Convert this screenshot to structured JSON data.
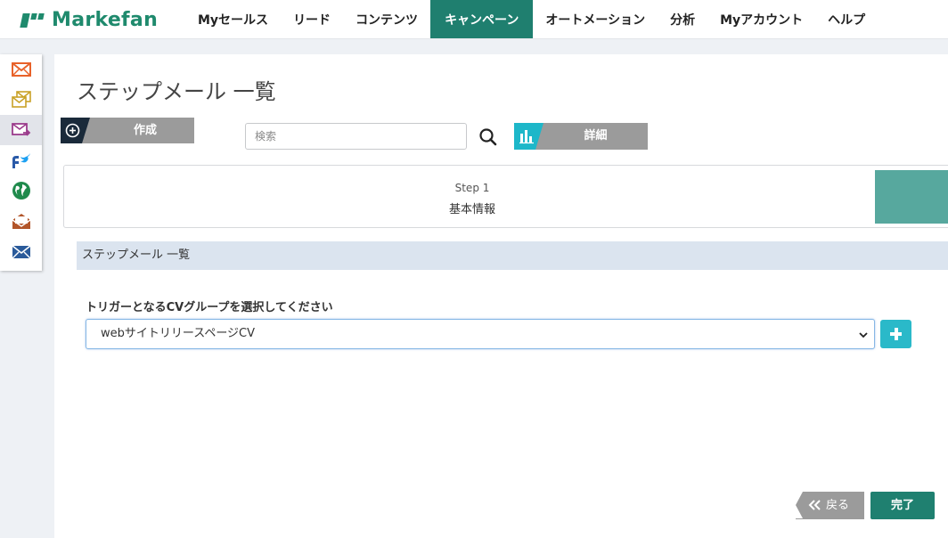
{
  "brand": {
    "name": "Markefan"
  },
  "nav": {
    "items": [
      {
        "label": "Myセールス"
      },
      {
        "label": "リード"
      },
      {
        "label": "コンテンツ"
      },
      {
        "label": "キャンペーン",
        "active": true
      },
      {
        "label": "オートメーション"
      },
      {
        "label": "分析"
      },
      {
        "label": "Myアカウント"
      },
      {
        "label": "ヘルプ"
      }
    ]
  },
  "sidebar": {
    "icons": [
      "mail-icon",
      "multi-mail-icon",
      "step-mail-icon",
      "social-icon",
      "globe-icon",
      "open-mail-icon",
      "campaign-mail-icon"
    ],
    "active_index": 2
  },
  "page": {
    "title": "ステップメール 一覧",
    "create_label": "作成",
    "search_placeholder": "検索",
    "detail_label": "詳細"
  },
  "step": {
    "number": "Step 1",
    "name": "基本情報"
  },
  "section": {
    "title": "ステップメール 一覧",
    "field_label": "トリガーとなるCVグループを選択してください",
    "selected_group": "webサイトリリースページCV"
  },
  "footer": {
    "back_label": "戻る",
    "done_label": "完了"
  },
  "colors": {
    "brand_green": "#1f8a6d",
    "nav_active": "#1f7f6f",
    "accent_cyan": "#1db7c9",
    "gray_button": "#9b9b9b",
    "section_bar": "#dbe4ef"
  }
}
